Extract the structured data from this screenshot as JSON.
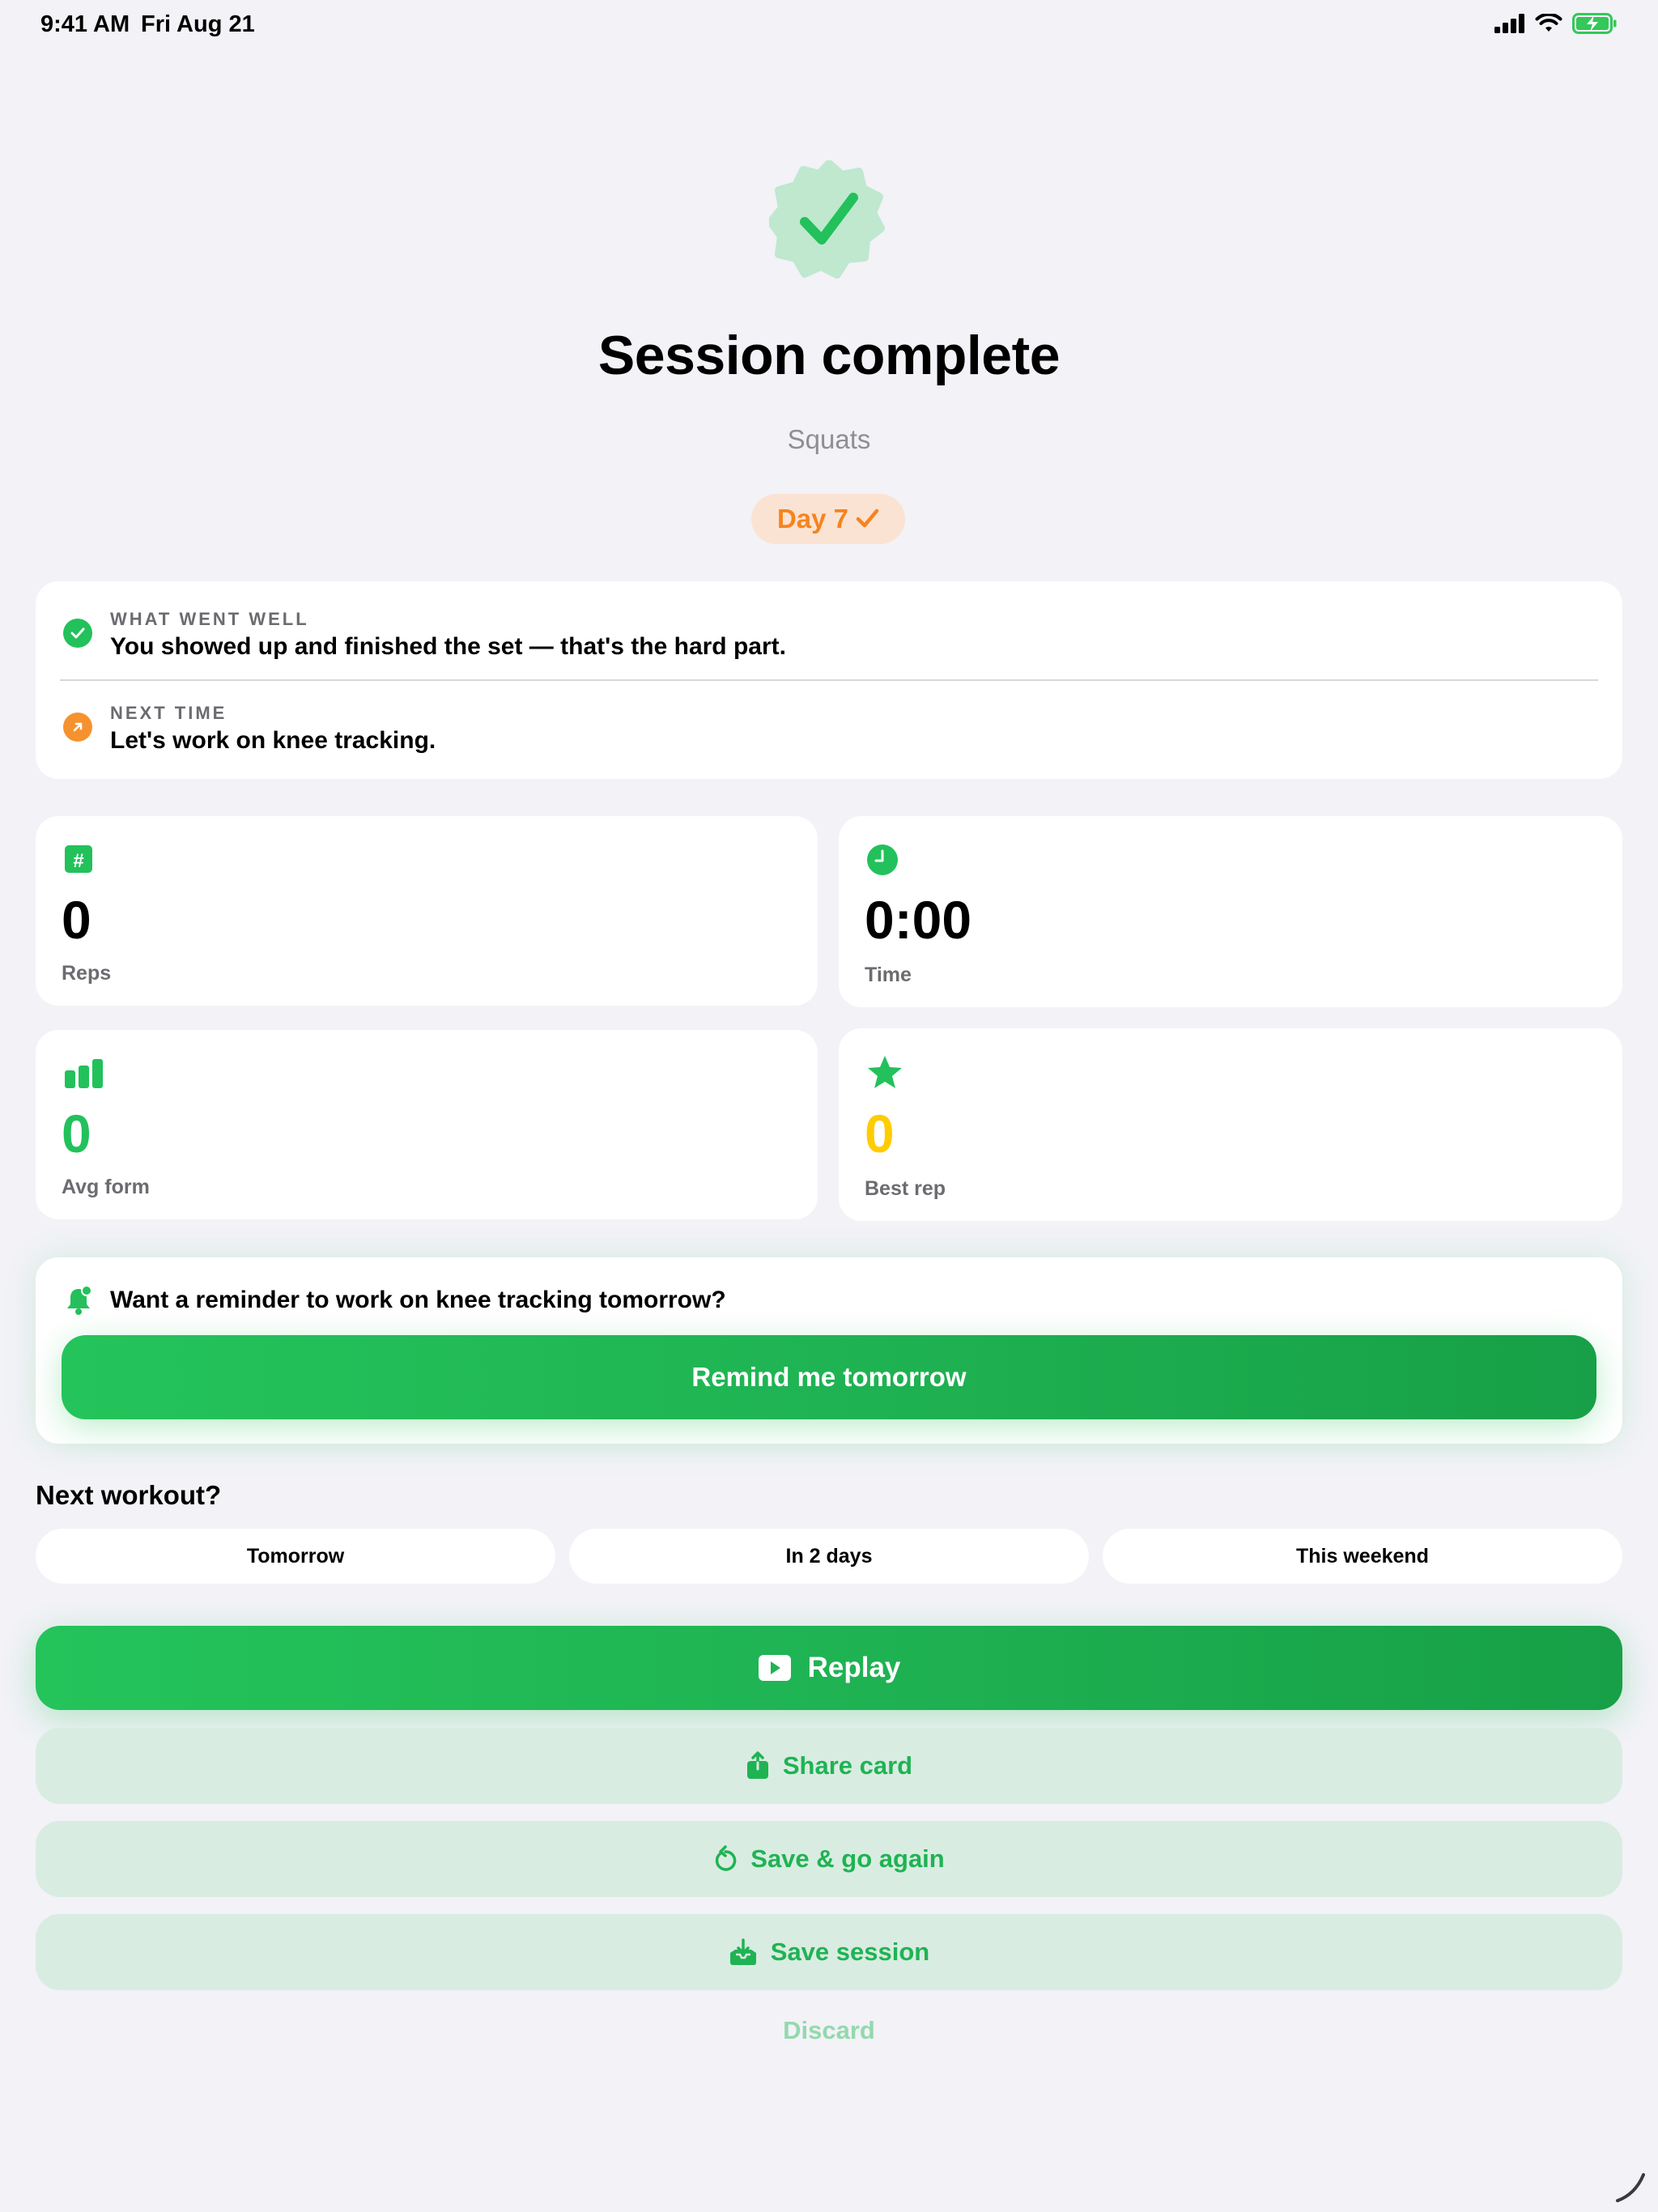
{
  "status_bar": {
    "time": "9:41 AM",
    "date": "Fri Aug 21",
    "icons": [
      "signal-icon",
      "wifi-icon",
      "battery-charging-icon"
    ]
  },
  "header": {
    "badge_icon": "checkmark-seal-icon",
    "title": "Session complete",
    "subtitle": "Squats",
    "day_pill": "Day 7"
  },
  "feedback": {
    "went_well_label": "WHAT WENT WELL",
    "went_well_text": "You showed up and finished the set — that's the hard part.",
    "next_time_label": "NEXT TIME",
    "next_time_text": "Let's work on knee tracking."
  },
  "stats": {
    "reps": {
      "value": "0",
      "label": "Reps",
      "icon": "number-icon"
    },
    "time": {
      "value": "0:00",
      "label": "Time",
      "icon": "clock-icon"
    },
    "avg_form": {
      "value": "0",
      "label": "Avg form",
      "icon": "bar-chart-icon"
    },
    "best_rep": {
      "value": "0",
      "label": "Best rep",
      "icon": "star-icon"
    }
  },
  "reminder": {
    "prompt": "Want a reminder to work on knee tracking tomorrow?",
    "button": "Remind me tomorrow"
  },
  "next_workout": {
    "label": "Next workout?",
    "options": [
      "Tomorrow",
      "In 2 days",
      "This weekend"
    ]
  },
  "actions": {
    "replay": "Replay",
    "share": "Share card",
    "save_again": "Save & go again",
    "save_session": "Save session",
    "discard": "Discard"
  },
  "colors": {
    "accent_green": "#24c45b",
    "orange": "#f5841f",
    "yellow": "#ffcc00",
    "background": "#f2f2f7"
  }
}
